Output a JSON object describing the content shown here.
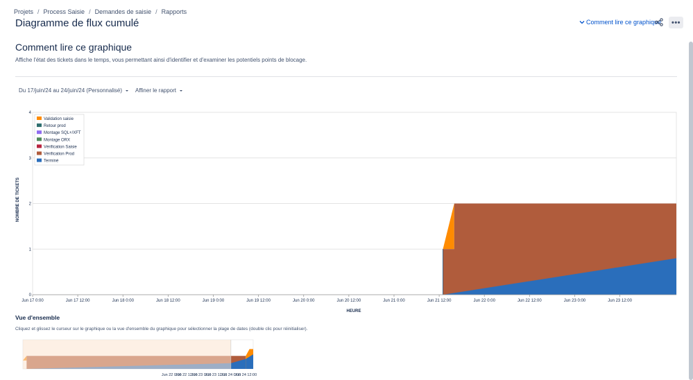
{
  "breadcrumbs": [
    "Projets",
    "Process Saisie",
    "Demandes de saisie",
    "Rapports"
  ],
  "page_title": "Diagramme de flux cumulé",
  "header": {
    "how_to_read_link": "Comment lire ce graphique",
    "more_label": "•••"
  },
  "section": {
    "title": "Comment lire ce graphique",
    "description": "Affiche l'état des tickets dans le temps, vous permettant ainsi d'identifier et d'examiner les potentiels points de blocage."
  },
  "filters": {
    "date_range": "Du 17/juin/24 au 24/juin/24 (Personnalisé)",
    "refine": "Affiner le rapport"
  },
  "overview": {
    "title": "Vue d'ensemble",
    "description": "Cliquez et glissez le curseur sur le graphique ou la vue d'ensemble du graphique pour sélectionner la plage de dates (double clic pour réinitialiser)."
  },
  "colors": {
    "validation_saisie": "#ff8b00",
    "retour_prod": "#2e6e6e",
    "montage_sql": "#8f6cf0",
    "montage_orx": "#4f8a5b",
    "verification_saisie": "#b8233f",
    "verification_prod": "#b05c3c",
    "termine": "#2a6ebb"
  },
  "chart_data": {
    "type": "area",
    "stacked": true,
    "xlabel": "HEURE",
    "ylabel": "NOMBRE DE TICKETS",
    "ylim": [
      0,
      4
    ],
    "y_ticks": [
      0,
      1,
      2,
      3,
      4
    ],
    "xlim": [
      "2024-06-17T00:00",
      "2024-06-24T03:00"
    ],
    "x_ticks": [
      "Jun 17 0:00",
      "Jun 17 12:00",
      "Jun 18 0:00",
      "Jun 18 12:00",
      "Jun 19 0:00",
      "Jun 19 12:00",
      "Jun 20 0:00",
      "Jun 20 12:00",
      "Jun 21 0:00",
      "Jun 21 12:00",
      "Jun 22 0:00",
      "Jun 22 12:00",
      "Jun 23 0:00",
      "Jun 23 12:00"
    ],
    "grid": true,
    "legend_position": "top-left",
    "series": [
      {
        "name": "Terminé",
        "color": "#2a6ebb",
        "points": [
          [
            "2024-06-21T13:00",
            0
          ],
          [
            "2024-06-24T03:00",
            0.8
          ]
        ]
      },
      {
        "name": "Vérification Prod",
        "color": "#b05c3c",
        "points": [
          [
            "2024-06-21T13:00",
            1
          ],
          [
            "2024-06-21T16:00",
            1
          ],
          [
            "2024-06-21T16:00",
            2
          ],
          [
            "2024-06-24T03:00",
            2
          ]
        ]
      },
      {
        "name": "Vérification Saisie",
        "color": "#b8233f",
        "points": []
      },
      {
        "name": "Montage ORX",
        "color": "#4f8a5b",
        "points": []
      },
      {
        "name": "Montage SQL+/XFT",
        "color": "#8f6cf0",
        "points": []
      },
      {
        "name": "Retour prod",
        "color": "#2e6e6e",
        "points": []
      },
      {
        "name": "Validation saisie",
        "color": "#ff8b00",
        "points": [
          [
            "2024-06-21T13:00",
            1
          ],
          [
            "2024-06-21T16:00",
            2
          ]
        ]
      }
    ]
  },
  "overview_chart": {
    "x_ticks": [
      "Jun 22 0:00",
      "Jun 22 12:00",
      "Jun 23 0:00",
      "Jun 23 12:00",
      "Jun 24 0:00",
      "Jun 24 12:00"
    ]
  }
}
